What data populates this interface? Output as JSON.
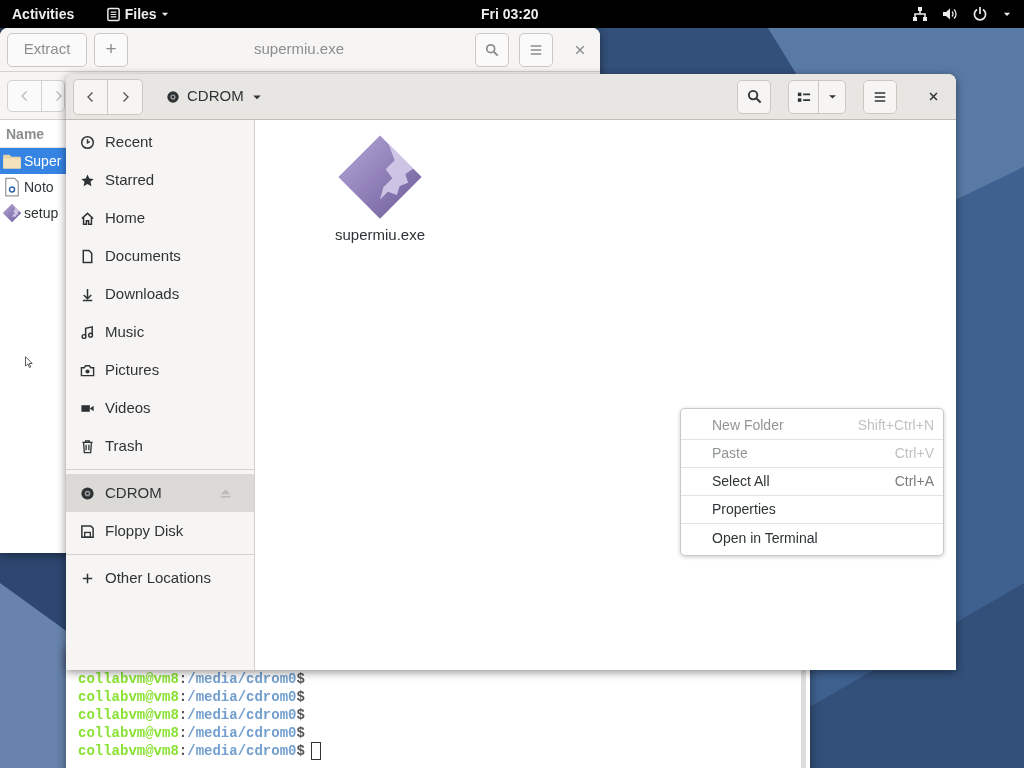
{
  "top_bar": {
    "activities": "Activities",
    "app_menu": "Files",
    "clock": "Fri 03:20"
  },
  "archive_window": {
    "title": "supermiu.exe",
    "buttons": [
      {
        "label": "Extract",
        "kind": "text"
      },
      {
        "label": "+",
        "kind": "text"
      }
    ],
    "column": "Name",
    "rows": [
      {
        "name": "Super",
        "kind": "folder",
        "selected": true
      },
      {
        "name": "Noto",
        "kind": "text",
        "selected": false
      },
      {
        "name": "setup",
        "kind": "package",
        "selected": false
      }
    ]
  },
  "files_window": {
    "location": "CDROM",
    "sidebar": [
      [
        {
          "label": "Recent",
          "kind": "recent",
          "selected": false
        },
        {
          "label": "Starred",
          "kind": "starred",
          "selected": false
        },
        {
          "label": "Home",
          "kind": "home",
          "selected": false
        },
        {
          "label": "Documents",
          "kind": "documents",
          "selected": false
        },
        {
          "label": "Downloads",
          "kind": "downloads",
          "selected": false
        },
        {
          "label": "Music",
          "kind": "music",
          "selected": false
        },
        {
          "label": "Pictures",
          "kind": "pictures",
          "selected": false
        },
        {
          "label": "Videos",
          "kind": "videos",
          "selected": false
        },
        {
          "label": "Trash",
          "kind": "trash",
          "selected": false
        }
      ],
      [
        {
          "label": "CDROM",
          "kind": "disc",
          "selected": true,
          "eject": true
        },
        {
          "label": "Floppy Disk",
          "kind": "floppy",
          "selected": false,
          "eject": false
        }
      ],
      [
        {
          "label": "Other Locations",
          "kind": "other",
          "selected": false
        }
      ]
    ],
    "files": [
      {
        "name": "supermiu.exe",
        "kind": "package"
      }
    ]
  },
  "context_menu": [
    {
      "label": "New Folder",
      "shortcut": "Shift+Ctrl+N",
      "disabled": true
    },
    {
      "label": "Paste",
      "shortcut": "Ctrl+V",
      "disabled": true
    },
    {
      "label": "Select All",
      "shortcut": "Ctrl+A",
      "disabled": false
    },
    {
      "label": "Properties",
      "disabled": false
    },
    {
      "label": "Open in Terminal",
      "disabled": false
    }
  ],
  "terminal": {
    "lines": [
      {
        "user": "collabvm@vm8",
        "sep": ":",
        "path": "/media/cdrom0",
        "end": "$",
        "cursor": false
      },
      {
        "user": "collabvm@vm8",
        "sep": ":",
        "path": "/media/cdrom0",
        "end": "$",
        "cursor": false
      },
      {
        "user": "collabvm@vm8",
        "sep": ":",
        "path": "/media/cdrom0",
        "end": "$",
        "cursor": false
      },
      {
        "user": "collabvm@vm8",
        "sep": ":",
        "path": "/media/cdrom0",
        "end": "$",
        "cursor": false
      },
      {
        "user": "collabvm@vm8",
        "sep": ":",
        "path": "/media/cdrom0",
        "end": "$",
        "cursor": true
      }
    ]
  }
}
